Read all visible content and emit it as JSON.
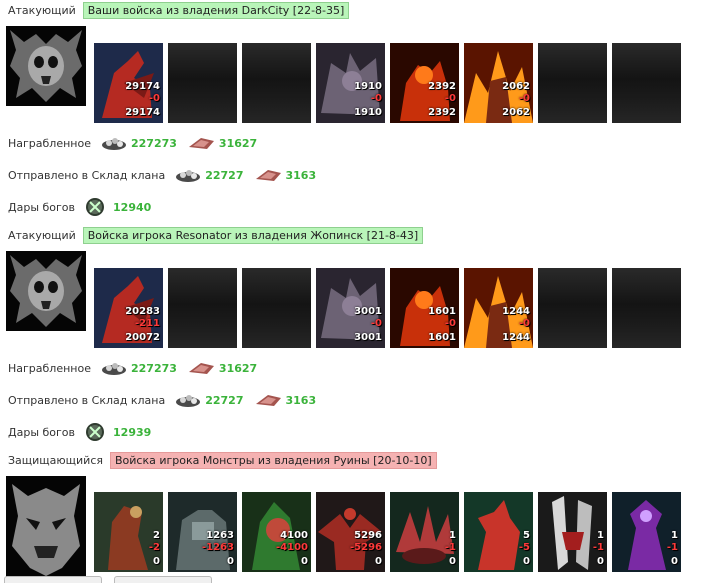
{
  "battles": [
    {
      "side_label": "Атакующий",
      "side_title": "Ваши войска из владения DarkCity [22-8-35]",
      "units": [
        {
          "n1": "29174",
          "n2": "-0",
          "n3": "29174"
        },
        null,
        null,
        {
          "n1": "1910",
          "n2": "-0",
          "n3": "1910"
        },
        {
          "n1": "2392",
          "n2": "-0",
          "n3": "2392"
        },
        {
          "n1": "2062",
          "n2": "-0",
          "n3": "2062"
        },
        null,
        null
      ],
      "loot_label": "Награбленное",
      "loot_ore": "227273",
      "loot_meat": "31627",
      "sent_label": "Отправлено в Склад клана",
      "sent_ore": "22727",
      "sent_meat": "3163",
      "gifts_label": "Дары богов",
      "gifts_value": "12940"
    },
    {
      "side_label": "Атакующий",
      "side_title": "Войска игрока Resonator из владения Жопинск [21-8-43]",
      "units": [
        {
          "n1": "20283",
          "n2": "-211",
          "n3": "20072"
        },
        null,
        null,
        {
          "n1": "3001",
          "n2": "-0",
          "n3": "3001"
        },
        {
          "n1": "1601",
          "n2": "-0",
          "n3": "1601"
        },
        {
          "n1": "1244",
          "n2": "-0",
          "n3": "1244"
        },
        null,
        null
      ],
      "loot_label": "Награбленное",
      "loot_ore": "227273",
      "loot_meat": "31627",
      "sent_label": "Отправлено в Склад клана",
      "sent_ore": "22727",
      "sent_meat": "3163",
      "gifts_label": "Дары богов",
      "gifts_value": "12939"
    }
  ],
  "defender": {
    "side_label": "Защищающийся",
    "side_title": "Войска игрока Монстры из владения Руины [20-10-10]",
    "units": [
      {
        "n1": "2",
        "n2": "-2",
        "n3": "0"
      },
      {
        "n1": "1263",
        "n2": "-1263",
        "n3": "0"
      },
      {
        "n1": "4100",
        "n2": "-4100",
        "n3": "0"
      },
      {
        "n1": "5296",
        "n2": "-5296",
        "n3": "0"
      },
      {
        "n1": "1",
        "n2": "-1",
        "n3": "0"
      },
      {
        "n1": "5",
        "n2": "-5",
        "n3": "0"
      },
      {
        "n1": "1",
        "n2": "-1",
        "n3": "0"
      },
      {
        "n1": "1",
        "n2": "-1",
        "n3": "0"
      }
    ]
  },
  "colors": {
    "attacker_badge": "#b9f5b9",
    "defender_badge": "#f5b2b2",
    "value_green": "#3bb33b",
    "loss_red": "#ff3a3a"
  }
}
